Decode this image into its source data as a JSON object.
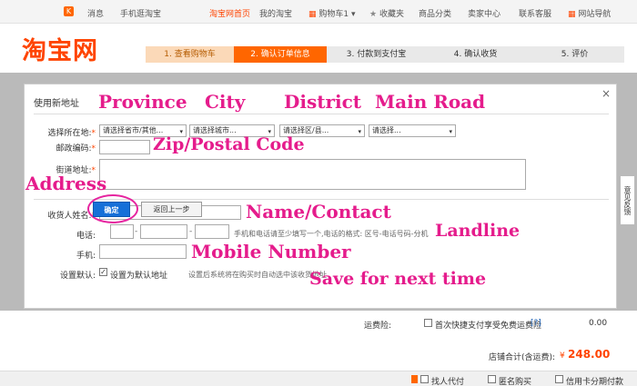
{
  "topbar": {
    "items": [
      "消息",
      "手机逛淘宝",
      "淘宝网首页",
      "我的淘宝",
      "购物车1",
      "收藏夹",
      "商品分类",
      "卖家中心",
      "联系客服",
      "网站导航"
    ]
  },
  "logo": "淘宝网",
  "steps": [
    "1. 查看购物车",
    "2. 确认订单信息",
    "3. 付款到支付宝",
    "4. 确认收货",
    "5. 评价"
  ],
  "modal": {
    "title": "使用新地址",
    "close": "×",
    "region_label": "选择所在地:",
    "province_placeholder": "请选择省市/其他...",
    "city_placeholder": "请选择城市...",
    "district_placeholder": "请选择区/县...",
    "street_placeholder": "请选择...",
    "zip_label": "邮政编码:",
    "address_label": "街道地址:",
    "name_label": "收货人姓名:",
    "phone_label": "电话:",
    "phone_hint": "手机和电话请至少填写一个,电话的格式: 区号-电话号码-分机",
    "mobile_label": "手机:",
    "default_label": "设置默认:",
    "default_checkbox_text": "设置为默认地址",
    "default_hint": "设置后系统将在购买时自动选中该收货地址",
    "confirm_button": "确定",
    "back_button": "返回上一步"
  },
  "annotations": {
    "province": "Province",
    "city": "City",
    "district": "District",
    "main_road": "Main Road",
    "zip": "Zip/Postal Code",
    "address": "Address",
    "name": "Name/Contact",
    "landline": "Landline",
    "mobile": "Mobile Number",
    "save": "Save for next time"
  },
  "sidetab": "意见反馈",
  "bottom": {
    "freight_label": "运费险:",
    "freight_checkbox_text": "首次快捷支付享受免费运费险",
    "help": "[?]",
    "freight_value": "0.00",
    "total_label": "店铺合计(含运费):",
    "yen": "¥",
    "total_value": "248.00",
    "bar_items": [
      "找人代付",
      "匿名购买",
      "信用卡分期付款"
    ]
  },
  "colors": {
    "accent": "#ff4400",
    "annotation": "#e51c8c",
    "primary_button": "#1670d8"
  }
}
